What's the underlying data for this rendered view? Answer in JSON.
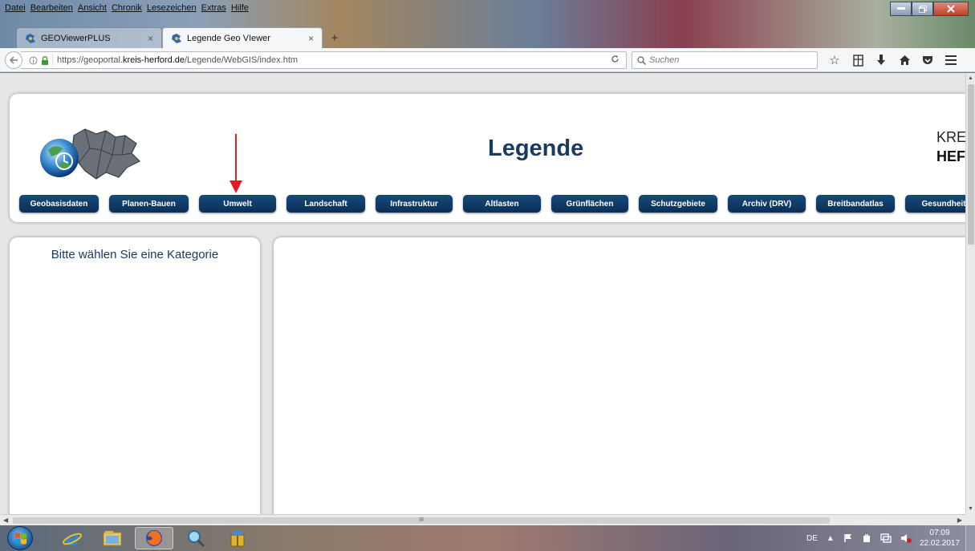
{
  "menu": [
    "Datei",
    "Bearbeiten",
    "Ansicht",
    "Chronik",
    "Lesezeichen",
    "Extras",
    "Hilfe"
  ],
  "tabs": [
    {
      "label": "GEOViewerPLUS",
      "active": false
    },
    {
      "label": "Legende Geo VIewer",
      "active": true
    }
  ],
  "tab_close": "×",
  "new_tab": "+",
  "urlbar": {
    "prefix": "https://geoportal.",
    "domain": "kreis-herford.de",
    "path": "/Legende/WebGIS/index.htm"
  },
  "search": {
    "placeholder": "Suchen"
  },
  "page": {
    "title": "Legende",
    "org_line1": "KRE",
    "org_line2": "HEF",
    "categories": [
      "Geobasisdaten",
      "Planen-Bauen",
      "Umwelt",
      "Landschaft",
      "Infrastruktur",
      "Altlasten",
      "Grünflächen",
      "Schutzgebiete",
      "Archiv (DRV)",
      "Breitbandatlas",
      "Gesundheit"
    ],
    "side_heading": "Bitte wählen Sie eine Kategorie"
  },
  "scrollbar": {
    "h_grip": "III"
  },
  "tray": {
    "language": "DE"
  },
  "clock": {
    "time": "07:09",
    "date": "22.02.2017"
  },
  "colors": {
    "accent": "#1a3a62",
    "button": "#0b2f56",
    "arrow": "#e02020"
  }
}
